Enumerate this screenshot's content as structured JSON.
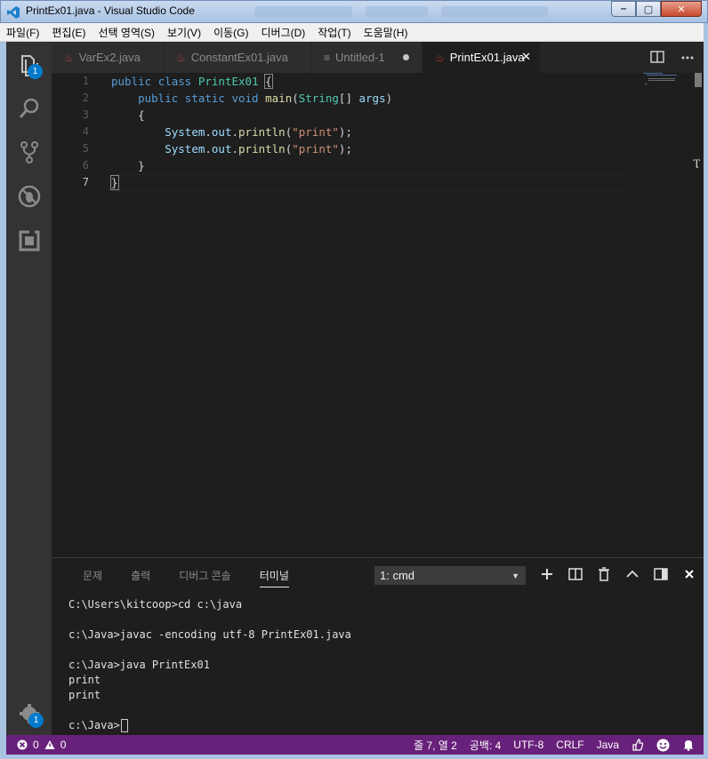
{
  "window": {
    "title": "PrintEx01.java - Visual Studio Code",
    "minimize": "‒",
    "maximize": "▢",
    "close": "✕"
  },
  "menu": [
    "파일(F)",
    "편집(E)",
    "선택 영역(S)",
    "보기(V)",
    "이동(G)",
    "디버그(D)",
    "작업(T)",
    "도움말(H)"
  ],
  "activity": {
    "explorer_badge": "1",
    "settings_badge": "1"
  },
  "tabs": [
    {
      "label": "VarEx2.java",
      "icon": "java-icon",
      "active": false
    },
    {
      "label": "ConstantEx01.java",
      "icon": "java-icon",
      "active": false
    },
    {
      "label": "Untitled-1",
      "icon": "text-file-icon",
      "active": false,
      "dirty": true
    },
    {
      "label": "PrintEx01.java",
      "icon": "java-icon",
      "active": true,
      "close": "✕"
    }
  ],
  "editor": {
    "line_numbers": [
      "1",
      "2",
      "3",
      "4",
      "5",
      "6",
      "7"
    ],
    "current_line": "7"
  },
  "panel": {
    "tabs": [
      "문제",
      "출력",
      "디버그 콘솔",
      "터미널"
    ],
    "active_tab": "터미널",
    "terminal_select": "1: cmd",
    "terminal_lines": [
      "C:\\Users\\kitcoop>cd c:\\java",
      "",
      "c:\\Java>javac -encoding utf-8 PrintEx01.java",
      "",
      "c:\\Java>java PrintEx01",
      "print",
      "print",
      "",
      "c:\\Java>"
    ]
  },
  "status": {
    "errors": "0",
    "warnings": "0",
    "position": "줄 7, 열 2",
    "spaces": "공백: 4",
    "encoding": "UTF-8",
    "eol": "CRLF",
    "language": "Java"
  },
  "colors": {
    "statusbar": "#68217a",
    "accent": "#007acc",
    "editor_bg": "#1e1e1e"
  }
}
